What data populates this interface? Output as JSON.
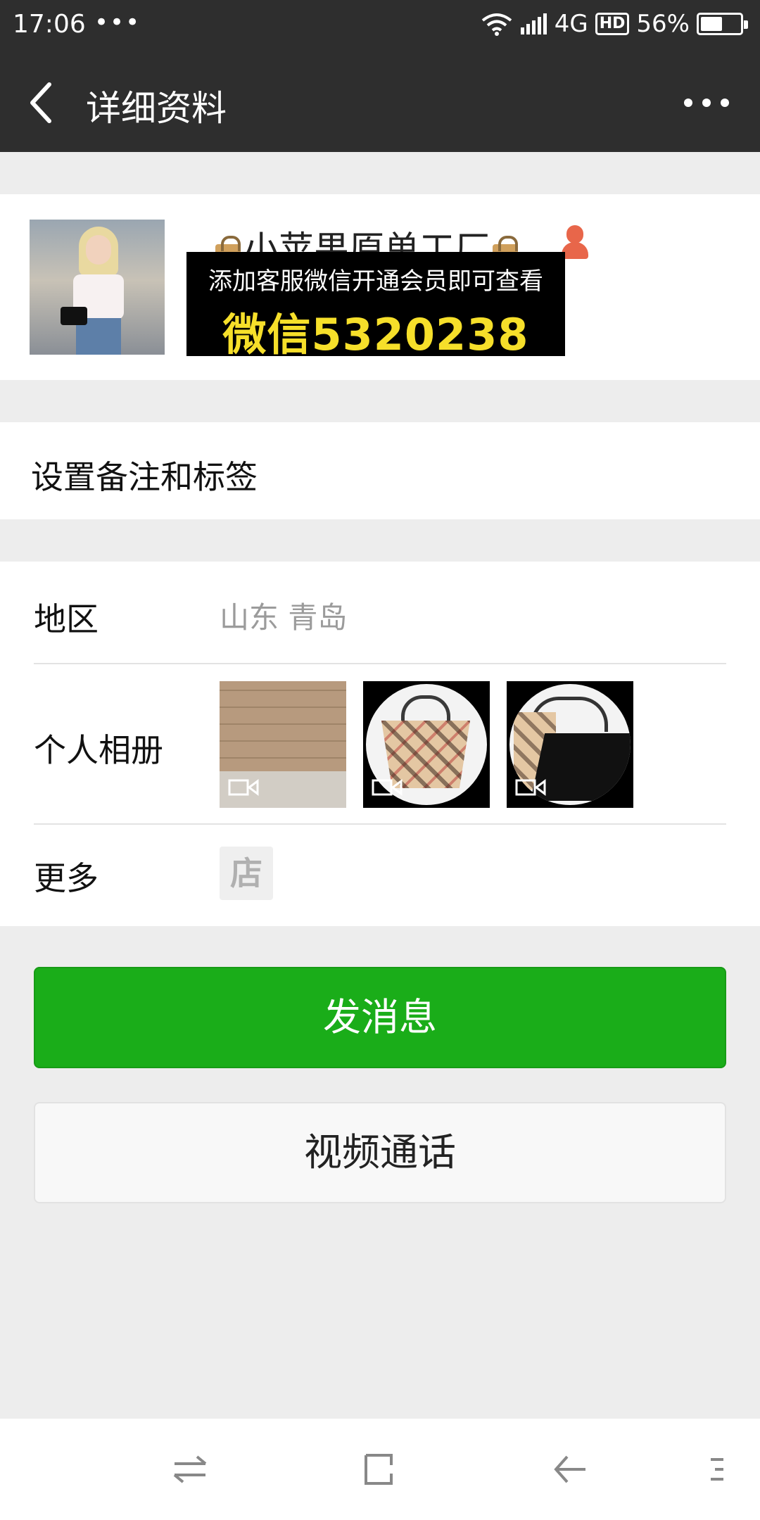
{
  "status_bar": {
    "time": "17:06",
    "dots": "•••",
    "network": "4G",
    "hd": "HD",
    "battery": "56%",
    "battery_level": 0.56
  },
  "header": {
    "title": "详细资料",
    "back_icon": "chevron-left-icon",
    "more_icon": "more-dots-icon"
  },
  "profile": {
    "nickname": "小苹果原单工厂",
    "banner_line1": "添加客服微信开通会员即可查看",
    "banner_line2": "微信5320238"
  },
  "remark": {
    "label": "设置备注和标签"
  },
  "info": {
    "region_label": "地区",
    "region_value": "山东  青岛",
    "album_label": "个人相册",
    "more_label": "更多",
    "shop_glyph": "店"
  },
  "actions": {
    "send_message": "发消息",
    "video_call": "视频通话"
  },
  "colors": {
    "header_bg": "#2e2e2e",
    "primary_green": "#1aad19",
    "page_bg": "#ededed",
    "banner_yellow": "#f6df2a"
  }
}
